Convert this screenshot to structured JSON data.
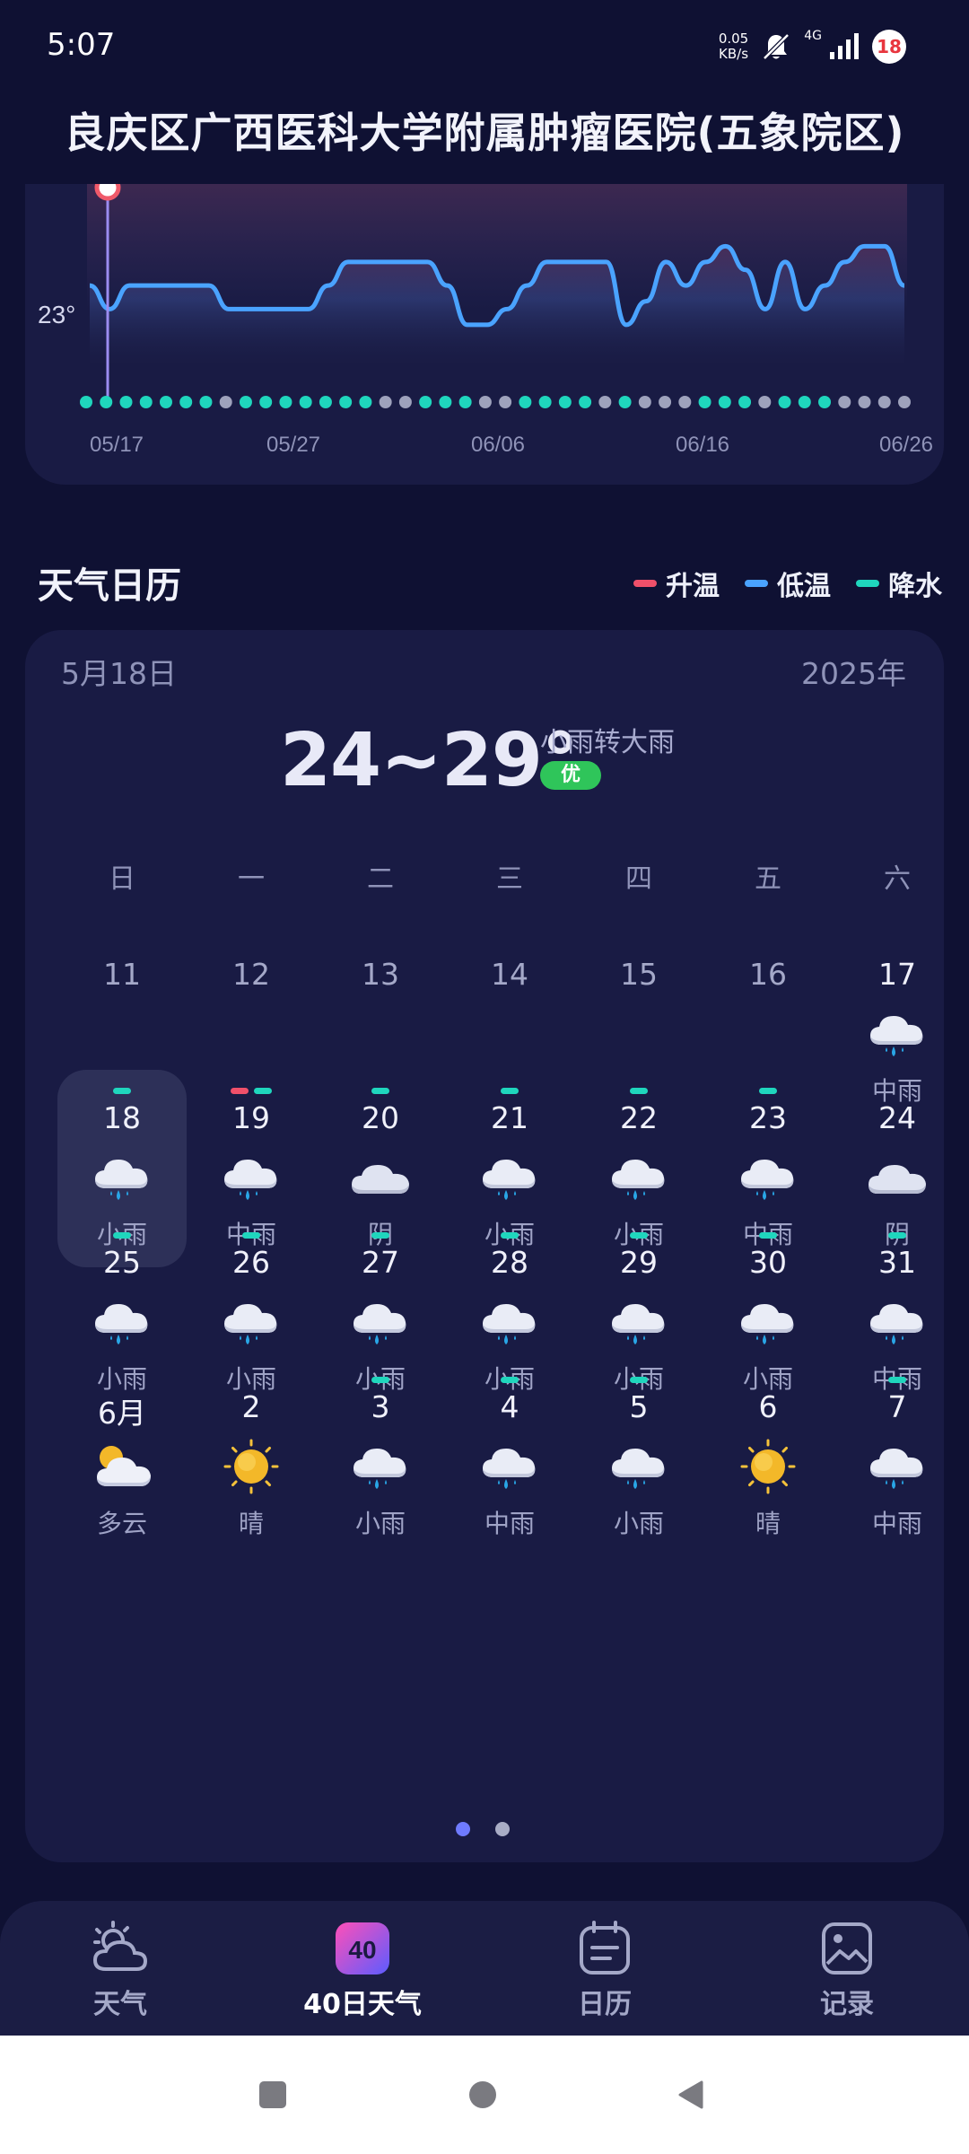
{
  "status_bar": {
    "time": "5:07",
    "net_speed_value": "0.05",
    "net_speed_unit": "KB/s",
    "signal_label": "4G",
    "notification_count": "18"
  },
  "title": "良庆区广西医科大学附属肿瘤医院(五象院区)",
  "chart_data": {
    "type": "line",
    "y_tick_labels": [
      "23°"
    ],
    "x_tick_labels": [
      "05/17",
      "05/27",
      "06/06",
      "06/16",
      "06/26"
    ],
    "series": [
      {
        "values": [
          23.6,
          23.0,
          23.6,
          23.6,
          23.6,
          23.6,
          23.6,
          23.0,
          23.0,
          23.0,
          23.0,
          23.0,
          23.6,
          24.2,
          24.2,
          24.2,
          24.2,
          24.2,
          23.6,
          22.6,
          22.6,
          23.0,
          23.6,
          24.2,
          24.2,
          24.2,
          24.2,
          22.6,
          23.2,
          24.2,
          23.6,
          24.2,
          24.6,
          24.0,
          23.0,
          24.2,
          23.0,
          23.6,
          24.2,
          24.6,
          24.6,
          23.6
        ],
        "color": "#4aa3ff"
      }
    ],
    "dot_colors": [
      "teal",
      "teal",
      "teal",
      "teal",
      "teal",
      "teal",
      "teal",
      "grey",
      "teal",
      "teal",
      "teal",
      "teal",
      "teal",
      "teal",
      "teal",
      "grey",
      "grey",
      "teal",
      "teal",
      "teal",
      "grey",
      "grey",
      "teal",
      "teal",
      "teal",
      "teal",
      "grey",
      "teal",
      "grey",
      "grey",
      "grey",
      "teal",
      "teal",
      "teal",
      "grey",
      "teal",
      "teal",
      "teal",
      "grey",
      "grey",
      "grey",
      "grey"
    ]
  },
  "calendar": {
    "section_title": "天气日历",
    "legend": [
      {
        "label": "升温",
        "color": "#f0506a"
      },
      {
        "label": "低温",
        "color": "#4aa3ff"
      },
      {
        "label": "降水",
        "color": "#1fd6bd"
      }
    ],
    "selected_date": "5月18日",
    "year": "2025年",
    "temp_range": "24~29°",
    "weather_desc": "小雨转大雨",
    "aqi": "优",
    "weekdays": [
      "日",
      "一",
      "二",
      "三",
      "四",
      "五",
      "六"
    ],
    "weeks": [
      [
        {
          "day": "11",
          "dim": true
        },
        {
          "day": "12",
          "dim": true
        },
        {
          "day": "13",
          "dim": true
        },
        {
          "day": "14",
          "dim": true
        },
        {
          "day": "15",
          "dim": true
        },
        {
          "day": "16",
          "dim": true
        },
        {
          "day": "17",
          "icon": "rain",
          "text": "中雨"
        }
      ],
      [
        {
          "day": "18",
          "icon": "rain",
          "text": "小雨",
          "marks": [
            "teal"
          ],
          "selected": true
        },
        {
          "day": "19",
          "icon": "rain",
          "text": "中雨",
          "marks": [
            "red",
            "teal"
          ]
        },
        {
          "day": "20",
          "icon": "cloud",
          "text": "阴",
          "marks": [
            "teal"
          ]
        },
        {
          "day": "21",
          "icon": "rain",
          "text": "小雨",
          "marks": [
            "teal"
          ]
        },
        {
          "day": "22",
          "icon": "rain",
          "text": "小雨",
          "marks": [
            "teal"
          ]
        },
        {
          "day": "23",
          "icon": "rain",
          "text": "中雨",
          "marks": [
            "teal"
          ]
        },
        {
          "day": "24",
          "icon": "cloud",
          "text": "阴"
        }
      ],
      [
        {
          "day": "25",
          "icon": "rain",
          "text": "小雨",
          "marks": [
            "teal"
          ]
        },
        {
          "day": "26",
          "icon": "rain",
          "text": "小雨",
          "marks": [
            "teal"
          ]
        },
        {
          "day": "27",
          "icon": "rain",
          "text": "小雨",
          "marks": [
            "teal"
          ]
        },
        {
          "day": "28",
          "icon": "rain",
          "text": "小雨",
          "marks": [
            "teal"
          ]
        },
        {
          "day": "29",
          "icon": "rain",
          "text": "小雨",
          "marks": [
            "teal"
          ]
        },
        {
          "day": "30",
          "icon": "rain",
          "text": "小雨",
          "marks": [
            "teal"
          ]
        },
        {
          "day": "31",
          "icon": "rain",
          "text": "中雨",
          "marks": [
            "teal"
          ]
        }
      ],
      [
        {
          "day": "6月",
          "icon": "partly-cloudy",
          "text": "多云"
        },
        {
          "day": "2",
          "icon": "sun",
          "text": "晴"
        },
        {
          "day": "3",
          "icon": "rain",
          "text": "小雨",
          "marks": [
            "teal"
          ]
        },
        {
          "day": "4",
          "icon": "rain",
          "text": "中雨",
          "marks": [
            "teal"
          ]
        },
        {
          "day": "5",
          "icon": "rain",
          "text": "小雨",
          "marks": [
            "teal"
          ]
        },
        {
          "day": "6",
          "icon": "sun",
          "text": "晴"
        },
        {
          "day": "7",
          "icon": "rain",
          "text": "中雨",
          "marks": [
            "teal"
          ]
        }
      ]
    ]
  },
  "bottom_nav": [
    {
      "label": "天气",
      "icon": "weather-icon",
      "active": false
    },
    {
      "label": "40日天气",
      "icon": "forty-day-icon",
      "badge": "40",
      "active": true
    },
    {
      "label": "日历",
      "icon": "calendar-icon",
      "active": false
    },
    {
      "label": "记录",
      "icon": "gallery-icon",
      "active": false
    }
  ]
}
